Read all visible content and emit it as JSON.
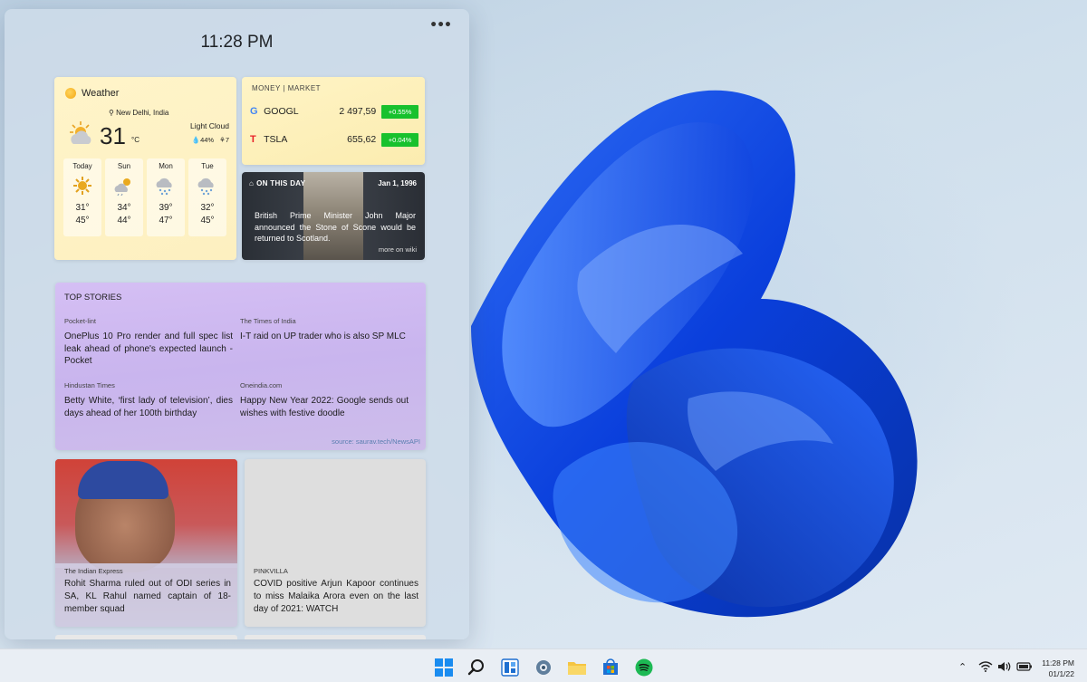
{
  "panel": {
    "time": "11:28 PM",
    "menu": "•••"
  },
  "weather": {
    "title": "Weather",
    "location": "New Delhi, India",
    "condition": "Light Cloud",
    "temperature": "31",
    "unit": "°C",
    "humidity": "44%",
    "wind": "7",
    "days": [
      {
        "name": "Today",
        "icon": "sun-icon",
        "high": "31°",
        "low": "45°"
      },
      {
        "name": "Sun",
        "icon": "cloud-sun-icon",
        "high": "34°",
        "low": "44°"
      },
      {
        "name": "Mon",
        "icon": "cloud-rain-icon",
        "high": "39°",
        "low": "47°"
      },
      {
        "name": "Tue",
        "icon": "cloud-rain-icon",
        "high": "32°",
        "low": "45°"
      }
    ]
  },
  "money": {
    "title": "MONEY | MARKET",
    "stocks": [
      {
        "symbol": "GOOGL",
        "logo": "G",
        "price": "2 497,59",
        "change": "+0.55%",
        "color": "#17c12d"
      },
      {
        "symbol": "TSLA",
        "logo": "T",
        "price": "655,62",
        "change": "+0.04%",
        "color": "#17c12d"
      }
    ]
  },
  "on_this_day": {
    "title": "ON THIS DAY",
    "date": "Jan 1, 1996",
    "text": "British Prime Minister John Major announced the Stone of Scone would be returned to Scotland.",
    "more": "more on wiki"
  },
  "top_stories": {
    "title": "TOP STORIES",
    "items": [
      {
        "source": "Pocket-lint",
        "headline": "OnePlus 10 Pro render and full spec list leak ahead of phone's expected launch - Pocket"
      },
      {
        "source": "The Times of India",
        "headline": "I-T raid on UP trader who is also SP MLC"
      },
      {
        "source": "Hindustan Times",
        "headline": "Betty White, ‘first lady of television’, dies days ahead of her 100th birthday"
      },
      {
        "source": "Oneindia.com",
        "headline": "Happy New Year 2022: Google sends out wishes with festive doodle"
      }
    ],
    "footer": "source: saurav.tech/NewsAPI"
  },
  "news_cards": [
    {
      "source": "The Indian Express",
      "headline": "Rohit Sharma ruled out of ODI series in SA, KL Rahul named captain of 18-member squad"
    },
    {
      "source": "PINKVILLA",
      "headline": "COVID positive Arjun Kapoor continues to miss Malaika Arora even on the last day of 2021: WATCH"
    }
  ],
  "taskbar": {
    "apps": [
      "windows-start-icon",
      "search-icon",
      "widgets-icon",
      "settings-icon",
      "file-explorer-icon",
      "store-icon",
      "spotify-icon"
    ],
    "time": "11:28 PM",
    "date": "01/1/22",
    "accent": "#0067c0"
  }
}
